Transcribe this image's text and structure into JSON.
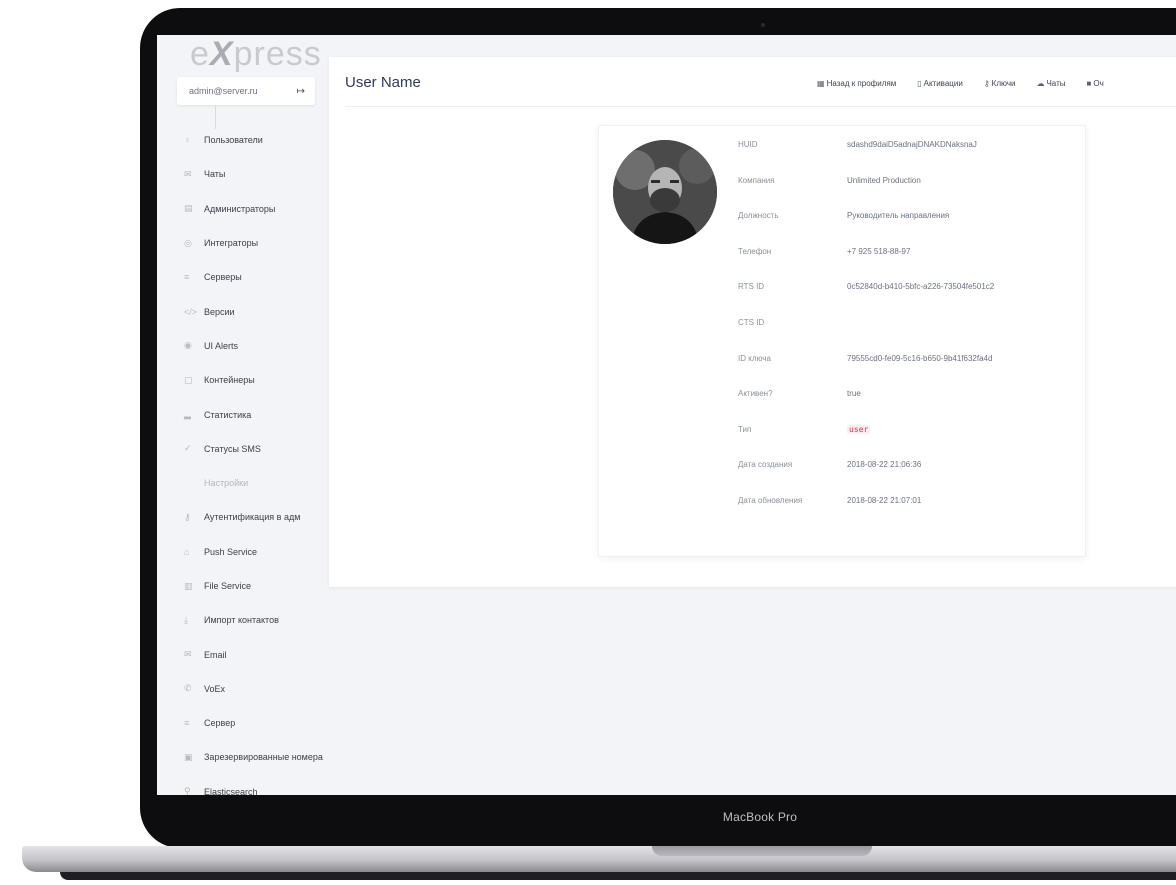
{
  "device": {
    "label": "MacBook Pro"
  },
  "logo": {
    "prefix": "e",
    "x": "X",
    "suffix": "press"
  },
  "account": {
    "email": "admin@server.ru",
    "logout_icon": "logout-icon"
  },
  "sidebar": {
    "items": [
      {
        "label": "Пользователи",
        "icon": "user-icon"
      },
      {
        "label": "Чаты",
        "icon": "chat-icon"
      },
      {
        "label": "Администраторы",
        "icon": "admin-icon"
      },
      {
        "label": "Интеграторы",
        "icon": "integrator-icon"
      },
      {
        "label": "Серверы",
        "icon": "servers-icon"
      },
      {
        "label": "Версии",
        "icon": "code-icon"
      },
      {
        "label": "UI Alerts",
        "icon": "alert-icon"
      },
      {
        "label": "Контейнеры",
        "icon": "container-icon"
      },
      {
        "label": "Статистика",
        "icon": "chart-icon"
      },
      {
        "label": "Статусы SMS",
        "icon": "check-icon"
      },
      {
        "label": "Настройки",
        "section": true
      },
      {
        "label": "Аутентификация в адм",
        "icon": "key-icon"
      },
      {
        "label": "Push Service",
        "icon": "bell-icon"
      },
      {
        "label": "File Service",
        "icon": "file-icon"
      },
      {
        "label": "Импорт контактов",
        "icon": "import-icon"
      },
      {
        "label": "Email",
        "icon": "mail-icon"
      },
      {
        "label": "VoEx",
        "icon": "phone-icon"
      },
      {
        "label": "Сервер",
        "icon": "server-icon"
      },
      {
        "label": "Зарезервированные номера",
        "icon": "reserved-icon"
      },
      {
        "label": "Elasticsearch",
        "icon": "search-icon"
      }
    ]
  },
  "main": {
    "title": "User Name",
    "nav": [
      {
        "label": "Назад к профилям",
        "icon": "list-icon"
      },
      {
        "label": "Активации",
        "icon": "activation-icon"
      },
      {
        "label": "Ключи",
        "icon": "key-icon"
      },
      {
        "label": "Чаты",
        "icon": "chat-icon"
      },
      {
        "label": "Оч",
        "icon": "clear-icon"
      }
    ]
  },
  "profile": {
    "fields": [
      {
        "label": "HUID",
        "value": "sdashd9daiD5adnajDNAKDNaksnaJ"
      },
      {
        "label": "Компания",
        "value": "Unlimited Production"
      },
      {
        "label": "Должность",
        "value": "Руководитель направления"
      },
      {
        "label": "Телефон",
        "value": "+7 925 518-88-97"
      },
      {
        "label": "RTS ID",
        "value": "0c52840d-b410-5bfc-a226-73504fe501c2"
      },
      {
        "label": "CTS ID",
        "value": ""
      },
      {
        "label": "ID ключа",
        "value": "79555cd0-fe09-5c16-b650-9b41f632fa4d"
      },
      {
        "label": "Активен?",
        "value": "true"
      },
      {
        "label": "Тип",
        "value": "user",
        "code": true
      },
      {
        "label": "Дата создания",
        "value": "2018-08-22 21:06:36"
      },
      {
        "label": "Дата обновления",
        "value": "2018-08-22 21:07:01"
      }
    ]
  }
}
